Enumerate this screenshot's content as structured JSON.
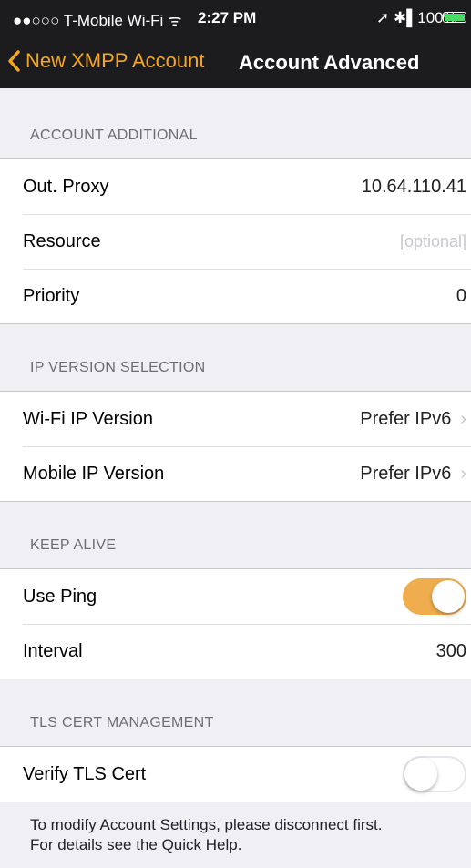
{
  "status_bar": {
    "carrier": "●●○○○ T-Mobile Wi-Fi",
    "wifi_icon": "wifi-icon",
    "time": "2:27 PM",
    "right": "➚ ✱▌100%",
    "battery_color": "#4cd964"
  },
  "nav": {
    "back_label": "New XMPP Account",
    "title": "Account Advanced",
    "accent": "#f5a623"
  },
  "sections": {
    "account_additional": {
      "header": "ACCOUNT ADDITIONAL",
      "out_proxy": {
        "label": "Out. Proxy",
        "value": "10.64.110.41"
      },
      "resource": {
        "label": "Resource",
        "placeholder": "[optional]"
      },
      "priority": {
        "label": "Priority",
        "value": "0"
      }
    },
    "ip_version": {
      "header": "IP VERSION SELECTION",
      "wifi": {
        "label": "Wi-Fi IP Version",
        "value": "Prefer IPv6"
      },
      "mobile": {
        "label": "Mobile IP Version",
        "value": "Prefer IPv6"
      }
    },
    "keep_alive": {
      "header": "KEEP ALIVE",
      "use_ping": {
        "label": "Use Ping",
        "on": true
      },
      "interval": {
        "label": "Interval",
        "value": "300"
      }
    },
    "tls": {
      "header": "TLS CERT MANAGEMENT",
      "verify": {
        "label": "Verify TLS Cert",
        "on": false
      }
    }
  },
  "footer": {
    "line1": "To modify Account Settings, please disconnect first.",
    "line2": "For details see the Quick Help."
  },
  "chevron": "›"
}
